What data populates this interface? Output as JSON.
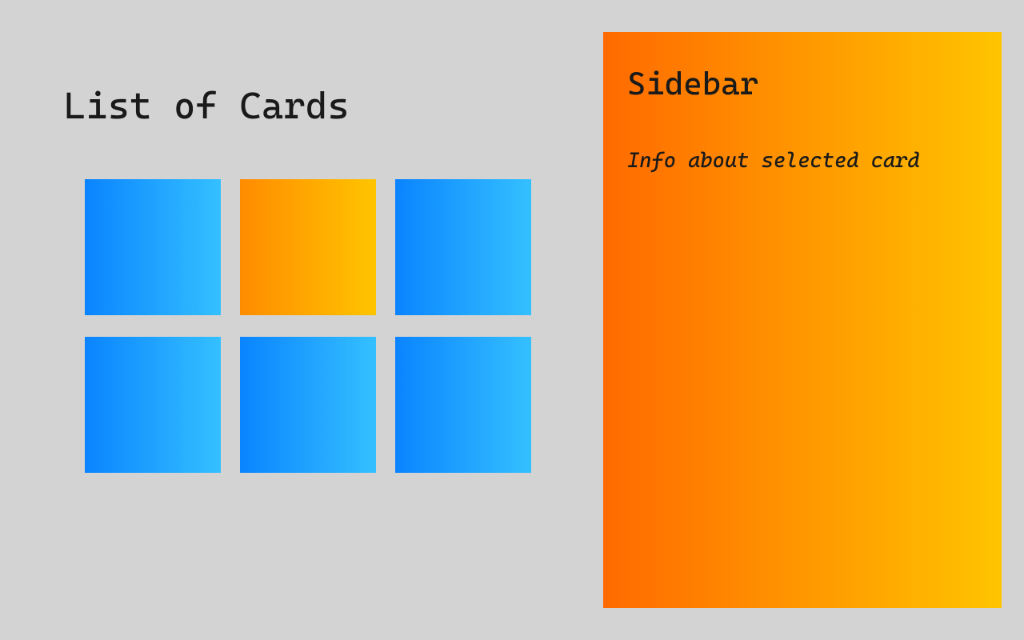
{
  "main": {
    "title": "List of Cards",
    "cards": [
      {
        "selected": false
      },
      {
        "selected": true
      },
      {
        "selected": false
      },
      {
        "selected": false
      },
      {
        "selected": false
      },
      {
        "selected": false
      }
    ]
  },
  "sidebar": {
    "title": "Sidebar",
    "info": "Info about selected card"
  }
}
